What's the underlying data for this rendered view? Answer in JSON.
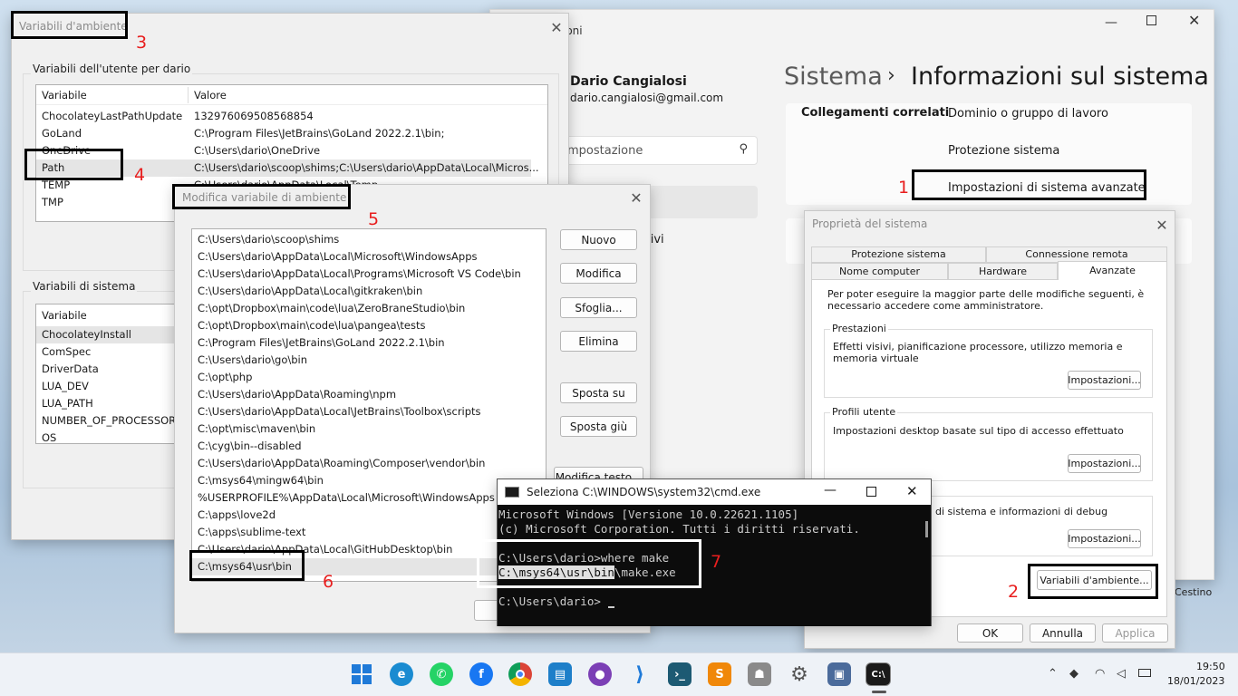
{
  "settings": {
    "window_title": "ioni",
    "user_name": "Dario Cangialosi",
    "user_email": "dario.cangialosi@gmail.com",
    "search_placeholder": "mpostazione",
    "breadcrumb_parent": "Sistema",
    "breadcrumb_sep": "›",
    "breadcrumb_current": "Informazioni sul sistema",
    "related_label": "Collegamenti correlati",
    "link_domain": "Dominio o gruppo di lavoro",
    "link_protection": "Protezione sistema",
    "link_advanced": "Impostazioni di sistema avanzate",
    "partial_text": "itivi",
    "trash_label": "Cestino"
  },
  "env_vars": {
    "title": "Variabili d'ambiente",
    "user_group": "Variabili dell'utente per dario",
    "col_variable": "Variabile",
    "col_value": "Valore",
    "user_rows": [
      {
        "name": "ChocolateyLastPathUpdate",
        "value": "132976069508568854"
      },
      {
        "name": "GoLand",
        "value": "C:\\Program Files\\JetBrains\\GoLand 2022.2.1\\bin;"
      },
      {
        "name": "OneDrive",
        "value": "C:\\Users\\dario\\OneDrive"
      },
      {
        "name": "Path",
        "value": "C:\\Users\\dario\\scoop\\shims;C:\\Users\\dario\\AppData\\Local\\Micros..."
      },
      {
        "name": "TEMP",
        "value": "C:\\Users\\dario\\AppData\\Local\\Temp"
      },
      {
        "name": "TMP",
        "value": ""
      }
    ],
    "system_group": "Variabili di sistema",
    "system_rows": [
      "ChocolateyInstall",
      "ComSpec",
      "DriverData",
      "LUA_DEV",
      "LUA_PATH",
      "NUMBER_OF_PROCESSORS",
      "OS"
    ]
  },
  "edit_var": {
    "title": "Modifica variabile di ambiente",
    "paths": [
      "C:\\Users\\dario\\scoop\\shims",
      "C:\\Users\\dario\\AppData\\Local\\Microsoft\\WindowsApps",
      "C:\\Users\\dario\\AppData\\Local\\Programs\\Microsoft VS Code\\bin",
      "C:\\Users\\dario\\AppData\\Local\\gitkraken\\bin",
      "C:\\opt\\Dropbox\\main\\code\\lua\\ZeroBraneStudio\\bin",
      "C:\\opt\\Dropbox\\main\\code\\lua\\pangea\\tests",
      "C:\\Program Files\\JetBrains\\GoLand 2022.2.1\\bin",
      "C:\\Users\\dario\\go\\bin",
      "C:\\opt\\php",
      "C:\\Users\\dario\\AppData\\Roaming\\npm",
      "C:\\Users\\dario\\AppData\\Local\\JetBrains\\Toolbox\\scripts",
      "C:\\opt\\misc\\maven\\bin",
      "C:\\cyg\\bin--disabled",
      "C:\\Users\\dario\\AppData\\Roaming\\Composer\\vendor\\bin",
      "C:\\msys64\\mingw64\\bin",
      "%USERPROFILE%\\AppData\\Local\\Microsoft\\WindowsApps",
      "C:\\apps\\love2d",
      "C:\\apps\\sublime-text",
      "C:\\Users\\dario\\AppData\\Local\\GitHubDesktop\\bin",
      "C:\\msys64\\usr\\bin"
    ],
    "btn_new": "Nuovo",
    "btn_edit": "Modifica",
    "btn_browse": "Sfoglia...",
    "btn_delete": "Elimina",
    "btn_up": "Sposta su",
    "btn_down": "Sposta giù",
    "btn_edit_text": "Modifica testo..."
  },
  "sys_props": {
    "title": "Proprietà del sistema",
    "tabs_row1": [
      "Protezione sistema",
      "Connessione remota"
    ],
    "tabs_row2": [
      "Nome computer",
      "Hardware",
      "Avanzate"
    ],
    "admin_note": "Per poter eseguire la maggior parte delle modifiche seguenti, è necessario accedere come amministratore.",
    "perf_title": "Prestazioni",
    "perf_desc": "Effetti visivi, pianificazione processore, utilizzo memoria e memoria virtuale",
    "profiles_title": "Profili utente",
    "profiles_desc": "Impostazioni desktop basate sul tipo di accesso effettuato",
    "startup_desc": "di sistema e informazioni di debug",
    "settings_btn": "Impostazioni...",
    "env_btn": "Variabili d'ambiente...",
    "ok": "OK",
    "cancel": "Annulla",
    "apply": "Applica"
  },
  "cmd": {
    "title": "Seleziona C:\\WINDOWS\\system32\\cmd.exe",
    "lines": [
      "Microsoft Windows [Versione 10.0.22621.1105]",
      "(c) Microsoft Corporation. Tutti i diritti riservati.",
      "",
      "C:\\Users\\dario>where make",
      "C:\\msys64\\usr\\bin\\make.exe",
      "",
      "C:\\Users\\dario>"
    ]
  },
  "annotations": [
    "1",
    "2",
    "3",
    "4",
    "5",
    "6",
    "7"
  ],
  "taskbar": {
    "time": "19:50",
    "date": "18/01/2023",
    "icons": [
      "windows-start-icon",
      "edge-icon",
      "whatsapp-icon",
      "facebook-icon",
      "chrome-icon",
      "notes-icon",
      "github-icon",
      "vscode-icon",
      "terminal-app-icon",
      "sublime-icon",
      "robot-app-icon",
      "settings-gear-icon",
      "system-props-icon",
      "cmd-icon"
    ]
  },
  "colors": {
    "annotation_red": "#e81e1e",
    "cmd_bg": "#0c0c0c",
    "selection": "#e5e5e5"
  }
}
